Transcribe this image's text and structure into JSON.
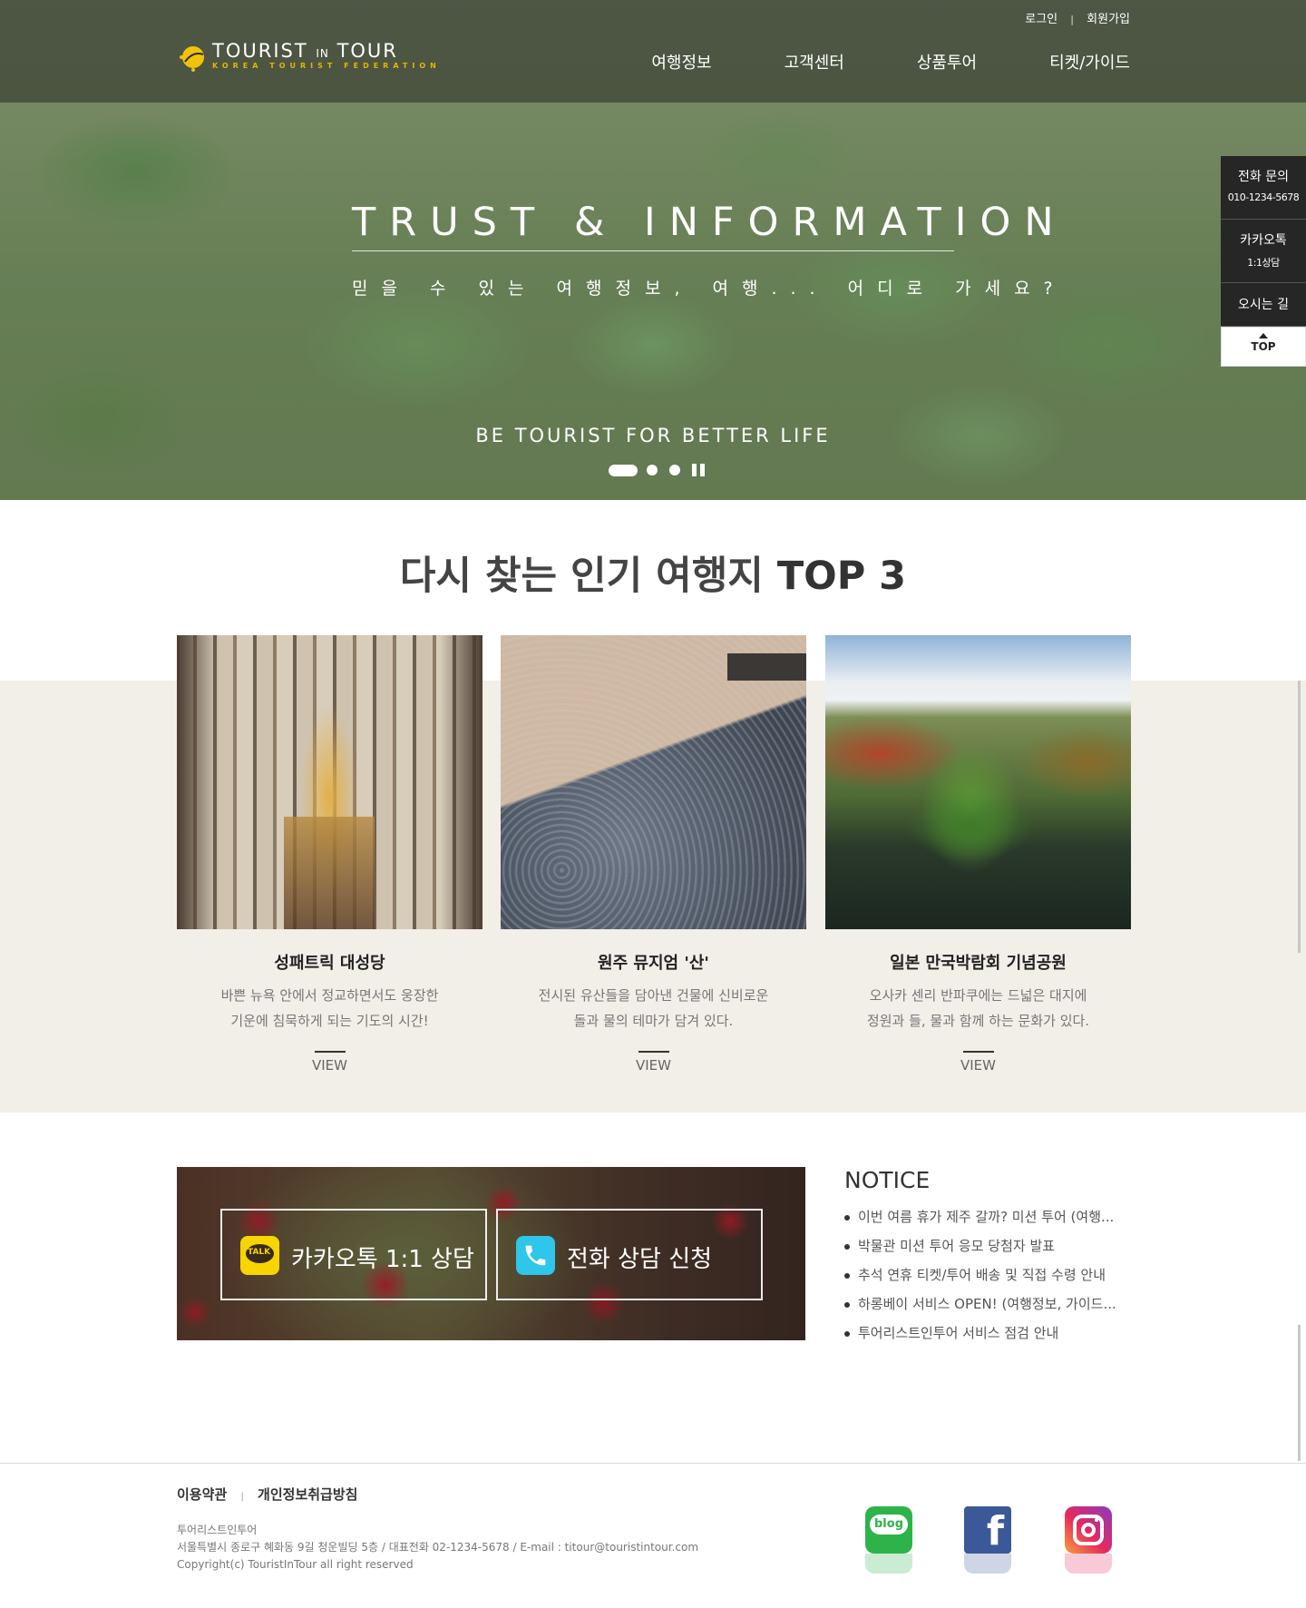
{
  "header": {
    "logo": {
      "title_main": "TOURIST",
      "title_small": "IN",
      "title_end": "TOUR",
      "subtitle": "KOREA TOURIST FEDERATION",
      "icon": "sun-logo-icon"
    },
    "util": {
      "login": "로그인",
      "separator": "|",
      "join": "회원가입"
    },
    "gnb": [
      "여행정보",
      "고객센터",
      "상품투어",
      "티켓/가이드"
    ]
  },
  "hero": {
    "title": "TRUST & INFORMATION",
    "subtitle": "믿을 수 있는 여행정보, 여행... 어디로 가세요?",
    "slogan": "BE TOURIST FOR BETTER LIFE",
    "slides_total": 3,
    "slide_active": 1
  },
  "quick_menu": {
    "phone": {
      "label": "전화 문의",
      "number": "010-1234-5678"
    },
    "kakao": {
      "label": "카카오톡",
      "sub": "1:1상담"
    },
    "directions": {
      "label": "오시는 길"
    },
    "top": {
      "label": "TOP"
    }
  },
  "top3": {
    "title_normal": "다시 찾는 인기 여행지",
    "title_bold": "TOP 3",
    "cards": [
      {
        "name": "성패트릭 대성당",
        "desc1": "바쁜 뉴욕 안에서 정교하면서도 웅장한",
        "desc2": "기운에 침묵하게 되는 기도의 시간!",
        "view": "VIEW"
      },
      {
        "name": "원주 뮤지엄 '산'",
        "desc1": "전시된 유산들을 담아낸 건물에 신비로운",
        "desc2": "돌과 물의 테마가 담겨 있다.",
        "view": "VIEW"
      },
      {
        "name": "일본 만국박람회 기념공원",
        "desc1": "오사카 센리 반파쿠에는 드넓은 대지에",
        "desc2": "정원과 들, 물과 함께 하는 문화가 있다.",
        "view": "VIEW"
      }
    ]
  },
  "consult": {
    "kakao_label": "카카오톡 1:1 상담",
    "kakao_icon_text": "TALK",
    "phone_label": "전화 상담 신청"
  },
  "notice": {
    "title": "NOTICE",
    "items": [
      "이번 여름 휴가 제주 갈까? 미션 투어 (여행...",
      "박물관 미션 투어 응모 당첨자 발표",
      "추석 연휴 티켓/투어 배송 및 직접 수령 안내",
      "하롱베이 서비스 OPEN! (여행정보, 가이드...",
      "투어리스트인투어 서비스 점검 안내"
    ]
  },
  "footer": {
    "terms": "이용약관",
    "separator": "|",
    "privacy": "개인정보취급방침",
    "company": "투어리스트인투어",
    "address": "서울특별시 종로구 혜화동 9길 청운빌딩 5층 / 대표전화 02-1234-5678 / E-mail : titour@touristintour.com",
    "copyright": "Copyright(c) TouristInTour all right reserved",
    "sns": {
      "blog_label": "blog",
      "facebook_label": "f"
    }
  },
  "colors": {
    "accent_gold": "#e8b400",
    "beige": "#f2eee8",
    "quick_bg": "#262626",
    "kakao_yellow": "#f6d500",
    "phone_cyan": "#2ec6ea"
  }
}
